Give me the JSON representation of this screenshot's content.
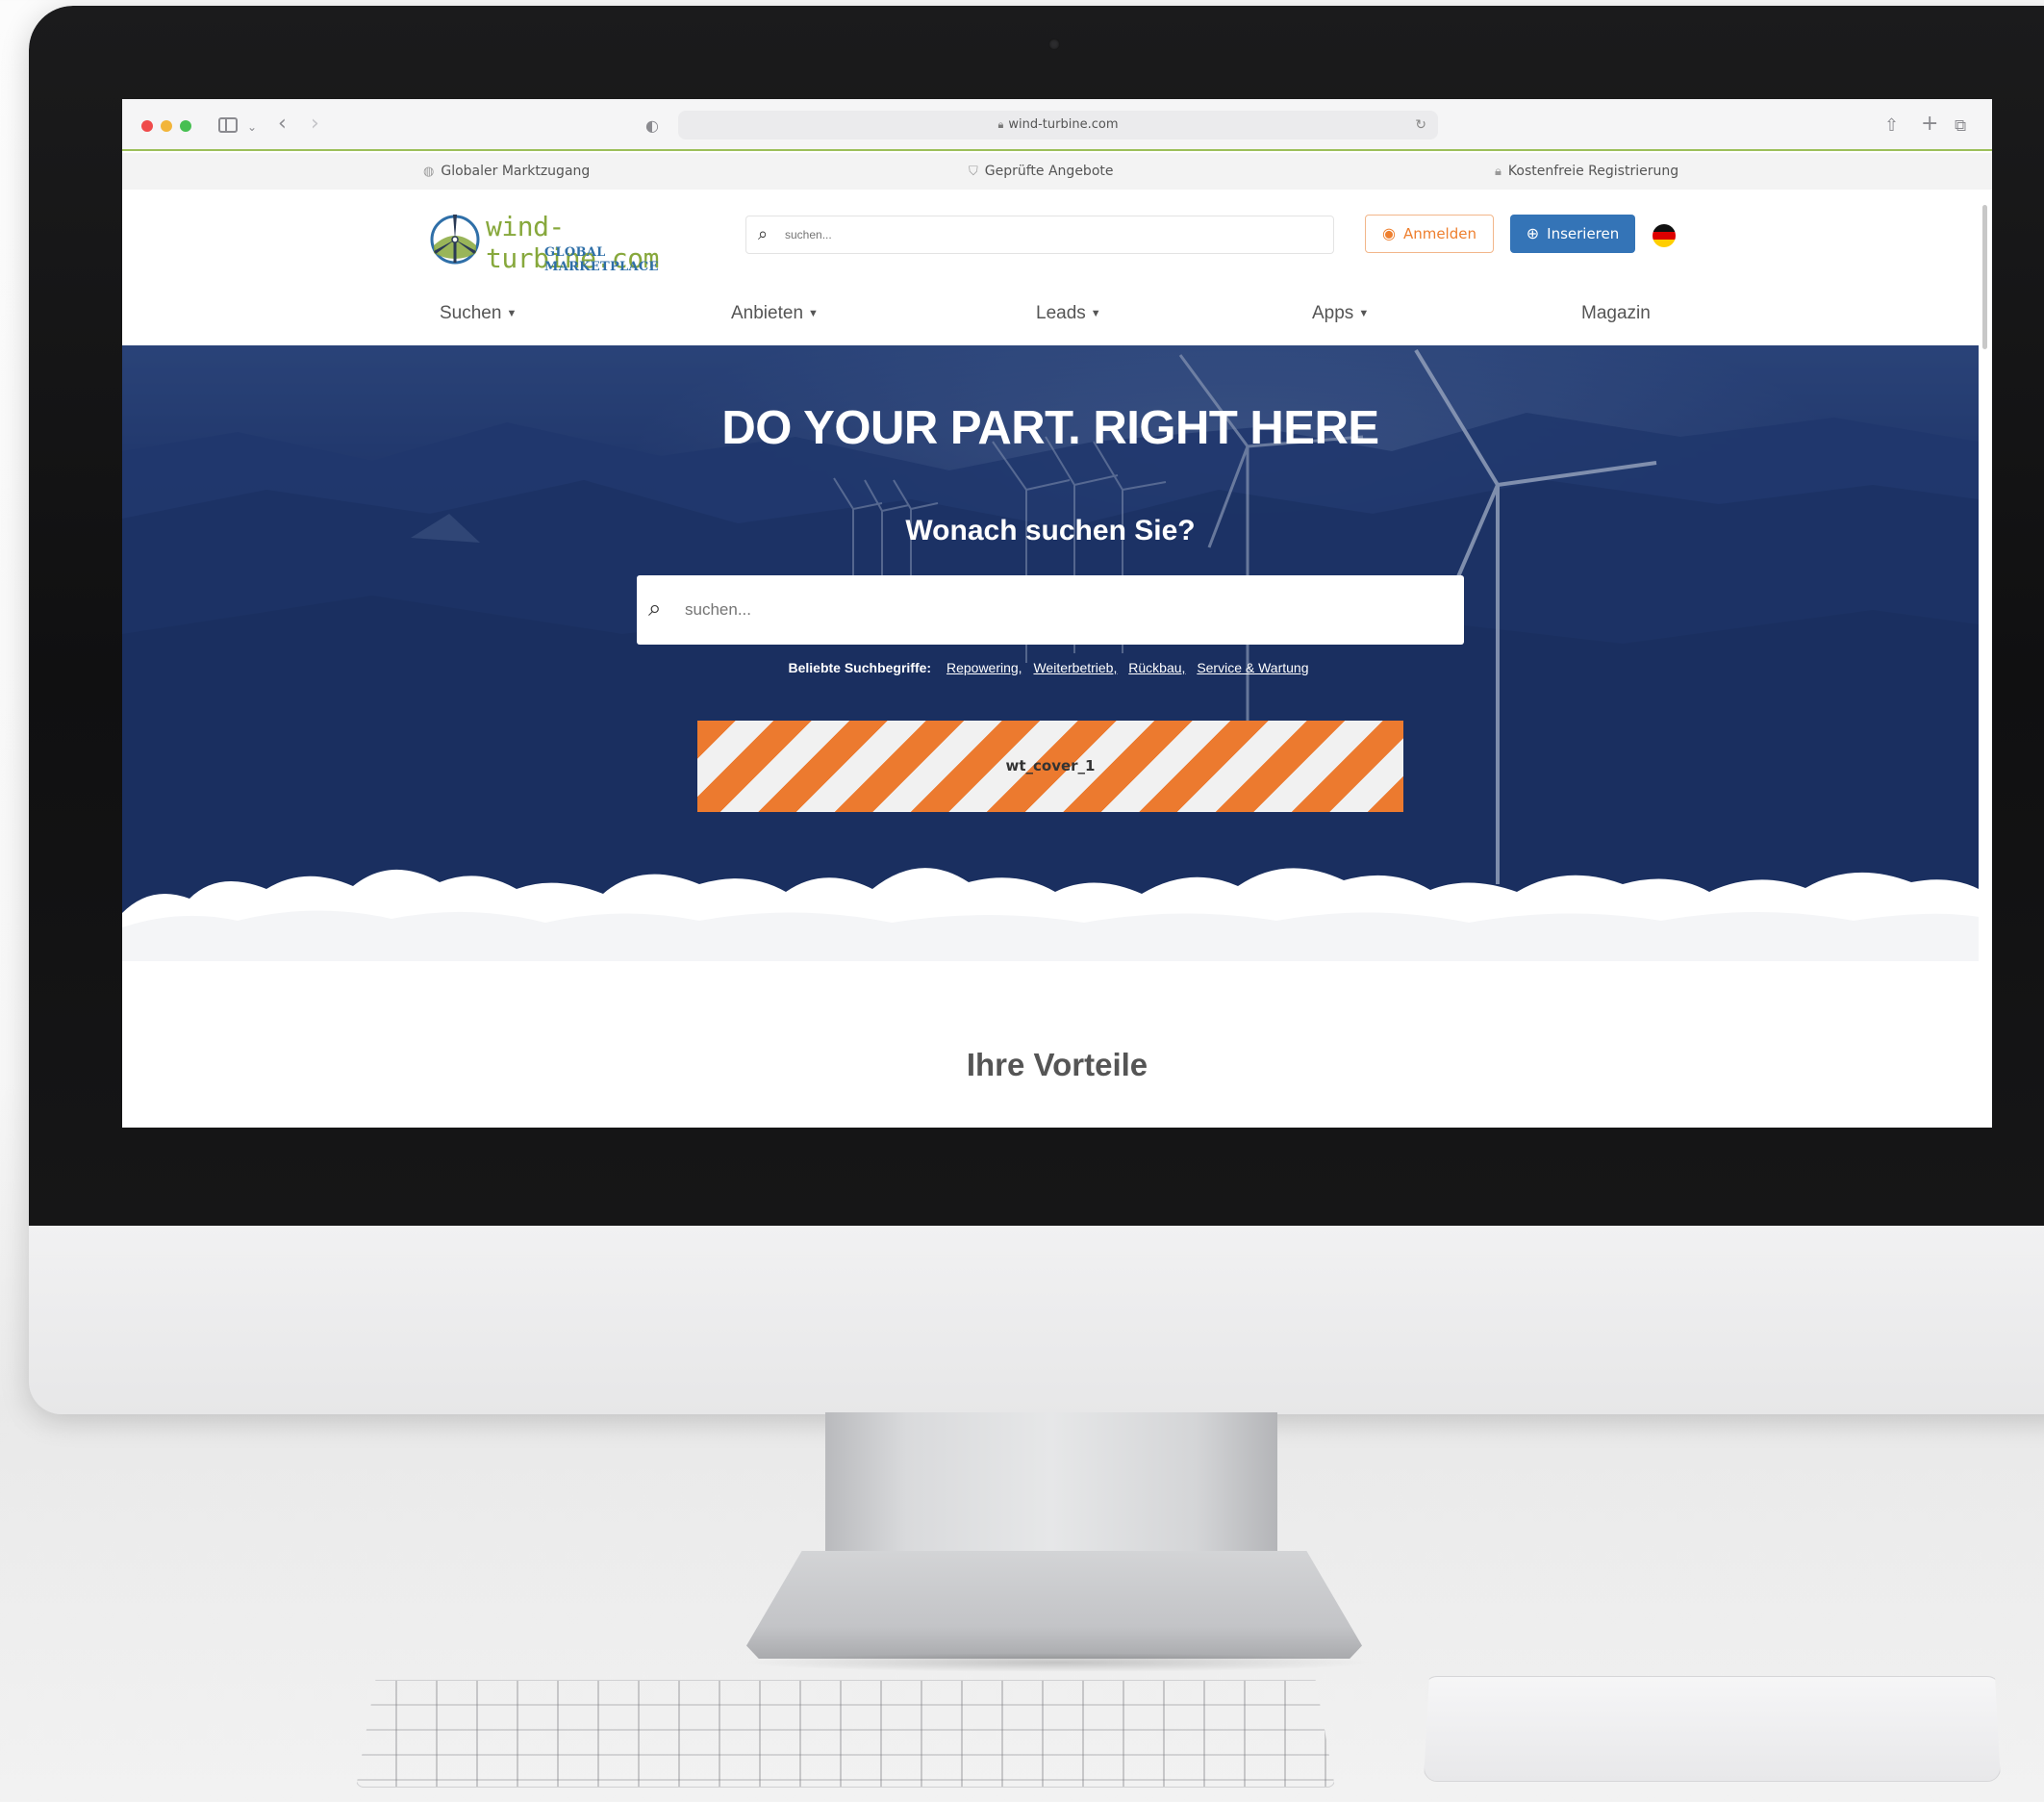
{
  "browser": {
    "url": "wind-turbine.com"
  },
  "trust_bar": {
    "items": [
      "Globaler Marktzugang",
      "Geprüfte Angebote",
      "Kostenfreie Registrierung"
    ]
  },
  "header": {
    "logo_text": "wind-turbine.com",
    "logo_sub": "GLOBAL MARKETPLACE",
    "search_placeholder": "suchen...",
    "login_label": "Anmelden",
    "post_label": "Inserieren",
    "language": "de"
  },
  "nav": {
    "items": [
      "Suchen",
      "Anbieten",
      "Leads",
      "Apps",
      "Magazin"
    ]
  },
  "hero": {
    "title": "DO YOUR PART. RIGHT HERE",
    "subtitle": "Wonach suchen Sie?",
    "search_placeholder": "suchen...",
    "popular_label": "Beliebte Suchbegriffe:",
    "popular_terms": [
      "Repowering,",
      "Weiterbetrieb,",
      "Rückbau,",
      "Service & Wartung"
    ],
    "banner_label": "wt_cover_1"
  },
  "section": {
    "title": "Ihre Vorteile"
  },
  "colors": {
    "accent_green": "#87a83c",
    "brand_blue": "#3474b7",
    "login_orange": "#ee7f2e",
    "hero_navy": "#1e3466"
  },
  "icons": {
    "trust": [
      "globe-icon",
      "shield-check-icon",
      "lock-icon"
    ],
    "login": "user-circle-icon",
    "post": "plus-circle-icon",
    "search": "search-icon"
  }
}
